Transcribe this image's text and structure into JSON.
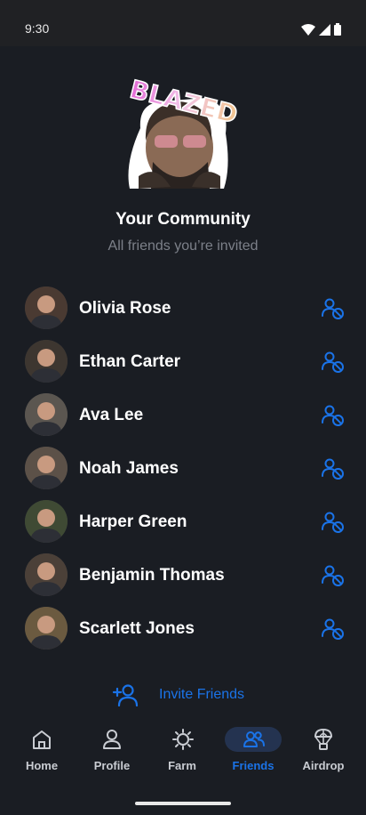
{
  "status_bar": {
    "time": "9:30"
  },
  "header": {
    "sticker_text": "BLAZED",
    "title": "Your Community",
    "subtitle": "All friends you’re invited"
  },
  "friends": [
    {
      "name": "Olivia Rose",
      "avatar_color": "#4a3a32"
    },
    {
      "name": "Ethan Carter",
      "avatar_color": "#3d3630"
    },
    {
      "name": "Ava Lee",
      "avatar_color": "#5b5650"
    },
    {
      "name": "Noah James",
      "avatar_color": "#5c5148"
    },
    {
      "name": "Harper Green",
      "avatar_color": "#3f4a34"
    },
    {
      "name": "Benjamin Thomas",
      "avatar_color": "#4b4038"
    },
    {
      "name": "Scarlett Jones",
      "avatar_color": "#6b5a40"
    }
  ],
  "invite": {
    "label": "Invite Friends"
  },
  "nav": {
    "items": [
      {
        "label": "Home",
        "icon": "home-icon"
      },
      {
        "label": "Profile",
        "icon": "profile-icon"
      },
      {
        "label": "Farm",
        "icon": "farm-icon"
      },
      {
        "label": "Friends",
        "icon": "friends-icon",
        "active": true
      },
      {
        "label": "Airdrop",
        "icon": "airdrop-icon"
      }
    ]
  },
  "colors": {
    "accent": "#1a73e8",
    "background": "#1a1d23",
    "muted": "#7c8089"
  }
}
